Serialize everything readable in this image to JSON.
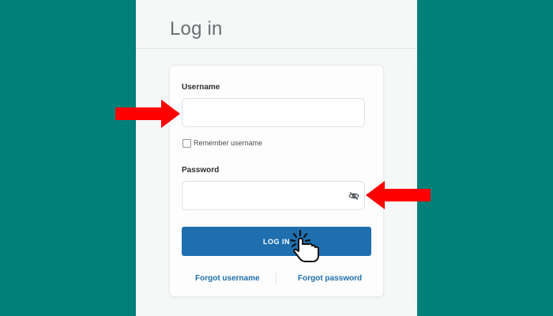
{
  "page": {
    "title": "Log in"
  },
  "form": {
    "username_label": "Username",
    "username_value": "",
    "remember_label": "Remember username",
    "remember_checked": false,
    "password_label": "Password",
    "password_value": "",
    "login_label": "LOG IN",
    "forgot_username_label": "Forgot username",
    "forgot_password_label": "Forgot password"
  },
  "icons": {
    "password_toggle": "eye-slash-icon",
    "annotation_arrows": "red-arrow-icon",
    "cursor": "pointer-hand-click-icon"
  },
  "colors": {
    "background": "#008078",
    "panel": "#f6f7f7",
    "card": "#fdfdfd",
    "primary_button": "#1f6fae",
    "link": "#1f6fae",
    "annotation_arrow": "#ff0000"
  }
}
